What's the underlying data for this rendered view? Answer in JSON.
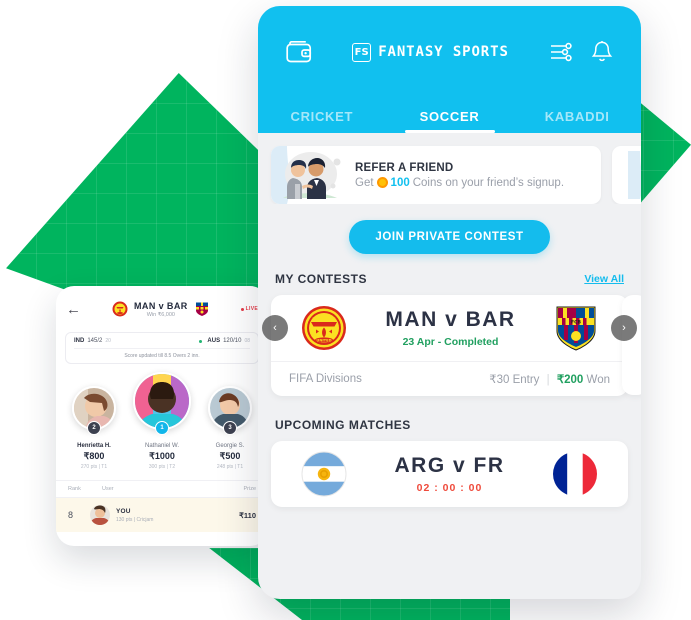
{
  "theme": {
    "brand_blue": "#11c0ef",
    "green": "#00b45e",
    "win_green": "#21a060",
    "timer_red": "#ef4b3c",
    "live_red": "#e63946"
  },
  "main_phone": {
    "header": {
      "wallet_icon": "wallet-icon",
      "brand_mark": "FS",
      "brand_name": "FANTASY SPORTS",
      "filter_icon": "sliders-icon",
      "bell_icon": "bell-icon"
    },
    "tabs": [
      {
        "label": "CRICKET",
        "active": false
      },
      {
        "label": "SOCCER",
        "active": true
      },
      {
        "label": "KABADDI",
        "active": false
      }
    ],
    "banner": {
      "title": "REFER A FRIEND",
      "sub_prefix": "Get",
      "coin_value": "100",
      "sub_suffix": "Coins on your friend’s signup.",
      "art": "two-friends-illustration"
    },
    "cta": {
      "label": "JOIN PRIVATE CONTEST"
    },
    "my_contests": {
      "title": "MY CONTESTS",
      "view_all": "View All",
      "prev_arrow": "‹",
      "next_arrow": "›",
      "card": {
        "home_crest": "manchester-united-crest",
        "away_crest": "fc-barcelona-crest",
        "match": "MAN  v  BAR",
        "status": "23 Apr - Completed",
        "league": "FIFA Divisions",
        "entry": "₹30 Entry",
        "separator": "|",
        "won_amount": "₹200",
        "won_label": "Won"
      }
    },
    "upcoming": {
      "title": "UPCOMING MATCHES",
      "card": {
        "home_crest": "argentina-flag",
        "away_crest": "france-flag",
        "match": "ARG  v  FR",
        "timer": "02 : 00 : 00"
      }
    }
  },
  "left_phone": {
    "back_icon": "←",
    "match": "MAN  v  BAR",
    "prize": "Win ₹6,000",
    "live_label": "LIVE",
    "score": {
      "team_a": "IND",
      "team_a_runs": "145/2",
      "team_a_overs": "20",
      "team_b": "AUS",
      "team_b_runs": "120/10",
      "team_b_overs": "08",
      "note": "Score updated till 8.5 Overs 2 inn."
    },
    "players": [
      {
        "rank": "2",
        "name": "Henrietta H.",
        "amount": "₹800",
        "points": "270 pts  |  T1",
        "lead": true
      },
      {
        "rank": "1",
        "name": "Nathaniel W.",
        "amount": "₹1000",
        "points": "300 pts  |  T2",
        "lead": false
      },
      {
        "rank": "3",
        "name": "Georgie S.",
        "amount": "₹500",
        "points": "248 pts  |  T1",
        "lead": false
      }
    ],
    "table": {
      "headers": {
        "rank": "Rank",
        "user": "User",
        "prize": "Prize"
      },
      "row": {
        "rank": "8",
        "name": "YOU",
        "sub": "130 pts  |  Cricjam",
        "prize": "₹110"
      }
    }
  }
}
